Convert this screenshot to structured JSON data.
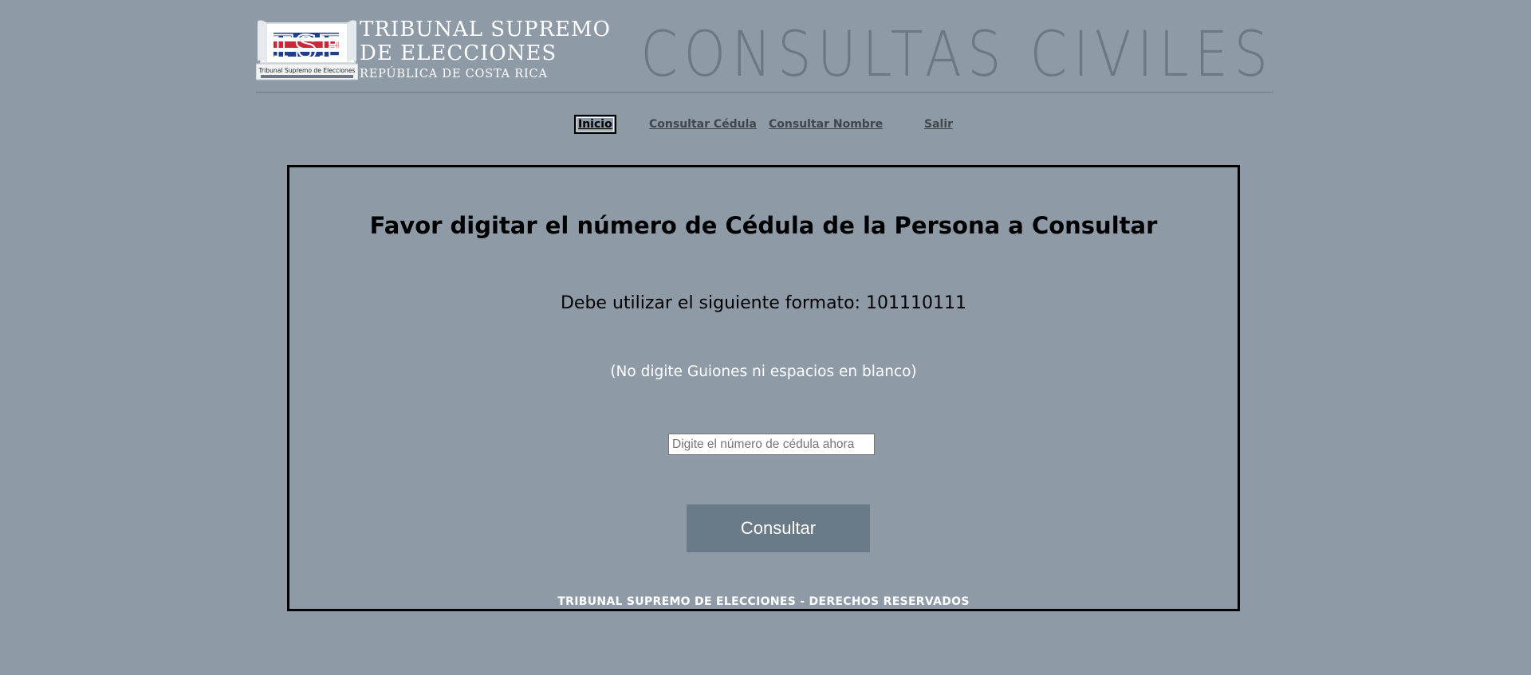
{
  "header": {
    "logo_badge": "TSE",
    "logo_ribbon": "Tribunal Supremo de Elecciones",
    "logo_line1": "TRIBUNAL SUPREMO",
    "logo_line2": "DE ELECCIONES",
    "logo_line3": "REPÚBLICA DE COSTA RICA",
    "site_title": "CONSULTAS CIVILES"
  },
  "nav": {
    "items": [
      {
        "label": "Inicio",
        "active": true
      },
      {
        "label": "Consultar Cédula"
      },
      {
        "label": "Consultar Nombre"
      },
      {
        "label": "Salir"
      }
    ]
  },
  "main": {
    "title": "Favor digitar el número de Cédula de la Persona a Consultar",
    "format_text": "Debe utilizar el siguiente formato: 101110111",
    "note_text": "(No digite Guiones ni espacios en blanco)",
    "input_placeholder": "Digite el número de cédula ahora",
    "input_value": "",
    "button_label": "Consultar"
  },
  "footer": {
    "text": "TRIBUNAL SUPREMO DE ELECCIONES - DERECHOS RESERVADOS"
  },
  "colors": {
    "background": "#8e9ba7",
    "button": "#6b7a87",
    "title_gray": "#6c7985"
  }
}
